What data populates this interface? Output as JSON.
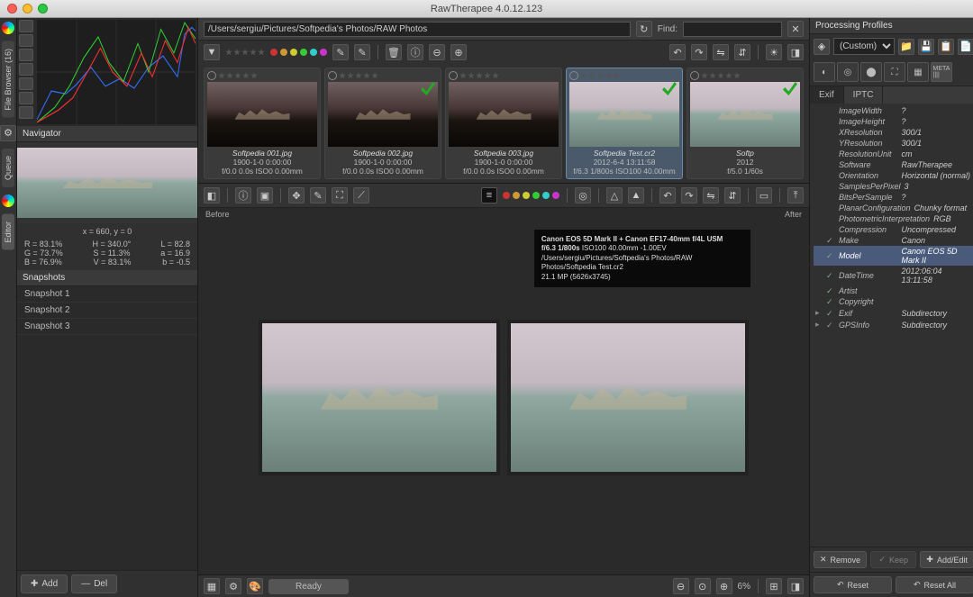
{
  "title": "RawTherapee 4.0.12.123",
  "sidebar_tabs": {
    "browser": "File Browser (16)",
    "queue": "Queue",
    "editor": "Editor"
  },
  "navigator": {
    "header": "Navigator",
    "pos": "x = 660, y = 0",
    "r": "R = 83.1%",
    "g": "G = 73.7%",
    "b": "B = 76.9%",
    "h": "H = 340.0°",
    "s": "S = 11.3%",
    "v": "V = 83.1%",
    "L": "L = 82.8",
    "a": "a = 16.9",
    "bv": "b = -0.5"
  },
  "snapshots": {
    "header": "Snapshots",
    "items": [
      "Snapshot 1",
      "Snapshot 2",
      "Snapshot 3"
    ]
  },
  "leftbtns": {
    "add": "Add",
    "del": "Del"
  },
  "path": "/Users/sergiu/Pictures/Softpedia's Photos/RAW Photos",
  "find_label": "Find:",
  "thumbs": [
    {
      "fn": "Softpedia 001.jpg",
      "l1": "1900-1-0 0:00:00",
      "l2": "f/0.0 0.0s ISO0 0.00mm",
      "dark": true,
      "check": false
    },
    {
      "fn": "Softpedia 002.jpg",
      "l1": "1900-1-0 0:00:00",
      "l2": "f/0.0 0.0s ISO0 0.00mm",
      "dark": true,
      "check": true
    },
    {
      "fn": "Softpedia 003.jpg",
      "l1": "1900-1-0 0:00:00",
      "l2": "f/0.0 0.0s ISO0 0.00mm",
      "dark": true,
      "check": false
    },
    {
      "fn": "Softpedia Test.cr2",
      "l1": "2012-6-4 13:11:58",
      "l2": "f/6.3 1/800s ISO100 40.00mm",
      "dark": false,
      "check": true,
      "sel": true
    },
    {
      "fn": "Softp",
      "l1": "2012",
      "l2": "f/5.0 1/60s",
      "dark": false,
      "check": true
    }
  ],
  "compare": {
    "before": "Before",
    "after": "After"
  },
  "infobox": {
    "l1": "Canon EOS 5D Mark II + Canon EF17-40mm f/4L USM",
    "l2a": "f/6.3  1/800s",
    "l2b": "ISO100  40.00mm  -1.00EV",
    "l3": "/Users/sergiu/Pictures/Softpedia's Photos/RAW Photos/Softpedia Test.cr2",
    "l4": "21.1 MP (5626x3745)"
  },
  "status": {
    "ready": "Ready",
    "zoom": "6%"
  },
  "profiles": {
    "header": "Processing Profiles",
    "selected": "(Custom)",
    "bundle_icon": "◈"
  },
  "metatabs": {
    "exif": "Exif",
    "iptc": "IPTC"
  },
  "exif": [
    {
      "k": "ImageWidth",
      "v": "?"
    },
    {
      "k": "ImageHeight",
      "v": "?"
    },
    {
      "k": "XResolution",
      "v": "300/1"
    },
    {
      "k": "YResolution",
      "v": "300/1"
    },
    {
      "k": "ResolutionUnit",
      "v": "cm"
    },
    {
      "k": "Software",
      "v": "RawTherapee"
    },
    {
      "k": "Orientation",
      "v": "Horizontal (normal)"
    },
    {
      "k": "SamplesPerPixel",
      "v": "3"
    },
    {
      "k": "BitsPerSample",
      "v": "?"
    },
    {
      "k": "PlanarConfiguration",
      "v": "Chunky format"
    },
    {
      "k": "PhotometricInterpretation",
      "v": "RGB"
    },
    {
      "k": "Compression",
      "v": "Uncompressed"
    },
    {
      "k": "Make",
      "v": "Canon",
      "ck": true
    },
    {
      "k": "Model",
      "v": "Canon EOS 5D Mark II",
      "ck": true,
      "hl": true
    },
    {
      "k": "DateTime",
      "v": "2012:06:04 13:11:58",
      "ck": true
    },
    {
      "k": "Artist",
      "v": "",
      "ck": true
    },
    {
      "k": "Copyright",
      "v": "",
      "ck": true
    },
    {
      "k": "Exif",
      "v": "Subdirectory",
      "ck": true,
      "tri": true
    },
    {
      "k": "GPSInfo",
      "v": "Subdirectory",
      "ck": true,
      "tri": true
    }
  ],
  "rbtns": {
    "remove": "Remove",
    "keep": "Keep",
    "addedit": "Add/Edit",
    "reset": "Reset",
    "resetall": "Reset All"
  },
  "colors": {
    "dots": [
      "#c33",
      "#c93",
      "#cc3",
      "#3c3",
      "#3cc",
      "#c3c"
    ]
  }
}
